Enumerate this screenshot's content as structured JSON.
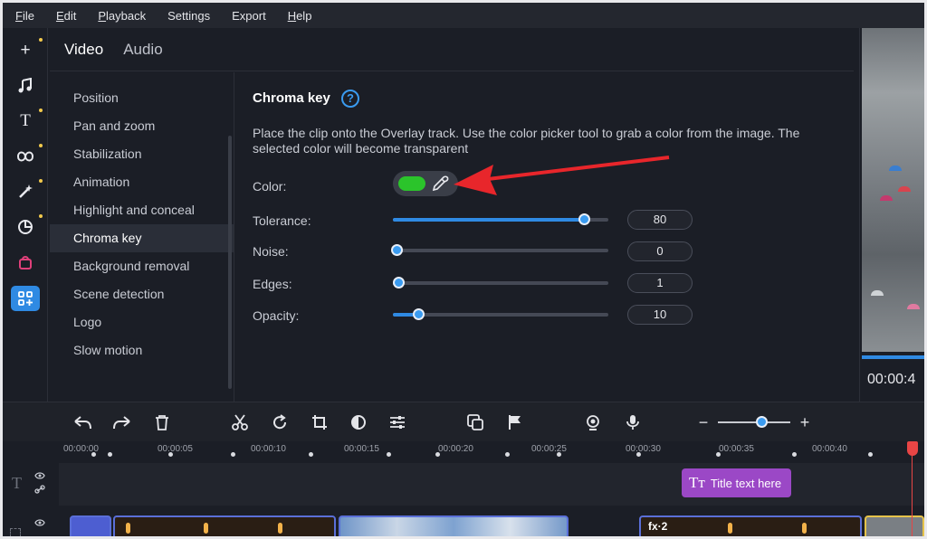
{
  "menu": {
    "items": [
      {
        "label": "File",
        "underline": "F",
        "rest": "ile"
      },
      {
        "label": "Edit",
        "underline": "E",
        "rest": "dit"
      },
      {
        "label": "Playback",
        "underline": "P",
        "rest": "layback"
      },
      {
        "label": "Settings",
        "underline": "S",
        "rest": "ettings"
      },
      {
        "label": "Export",
        "underline": "E",
        "rest": "xport"
      },
      {
        "label": "Help",
        "underline": "H",
        "rest": "elp"
      }
    ]
  },
  "rail": {
    "icons": [
      "add-icon",
      "music-icon",
      "text-icon",
      "transitions-icon",
      "effects-icon",
      "stickers-icon",
      "store-icon",
      "more-tools-icon"
    ],
    "accent": "#2f8ae3"
  },
  "tabs": [
    {
      "label": "Video",
      "active": true
    },
    {
      "label": "Audio",
      "active": false
    }
  ],
  "sidelist": {
    "items": [
      "Position",
      "Pan and zoom",
      "Stabilization",
      "Animation",
      "Highlight and conceal",
      "Chroma key",
      "Background removal",
      "Scene detection",
      "Logo",
      "Slow motion"
    ],
    "selected": "Chroma key"
  },
  "panel": {
    "title": "Chroma key",
    "help": "?",
    "description": "Place the clip onto the Overlay track. Use the color picker tool to grab a color from the image. The selected color will become transparent",
    "color_label": "Color:",
    "picked_color": "#2bc42b",
    "sliders": [
      {
        "label": "Tolerance:",
        "value": "80",
        "fraction": 0.87
      },
      {
        "label": "Noise:",
        "value": "0",
        "fraction": 0.0
      },
      {
        "label": "Edges:",
        "value": "1",
        "fraction": 0.01
      },
      {
        "label": "Opacity:",
        "value": "10",
        "fraction": 0.1
      }
    ]
  },
  "preview": {
    "time": "00:00:4"
  },
  "toolbar": {
    "icons": [
      "undo-icon",
      "redo-icon",
      "delete-icon",
      "cut-icon",
      "rotate-icon",
      "crop-icon",
      "color-adjust-icon",
      "properties-icon",
      "overlay-icon",
      "marker-flag-icon",
      "webcam-icon",
      "microphone-icon"
    ],
    "zoom_minus": "−",
    "zoom_plus": "+",
    "zoom_level": 0.6
  },
  "timeline": {
    "ticks": [
      "00:00:00",
      "00:00:05",
      "00:00:10",
      "00:00:15",
      "00:00:20",
      "00:00:25",
      "00:00:30",
      "00:00:35",
      "00:00:40"
    ],
    "title_clip": "Title text here",
    "fx_label": "fx·2"
  }
}
